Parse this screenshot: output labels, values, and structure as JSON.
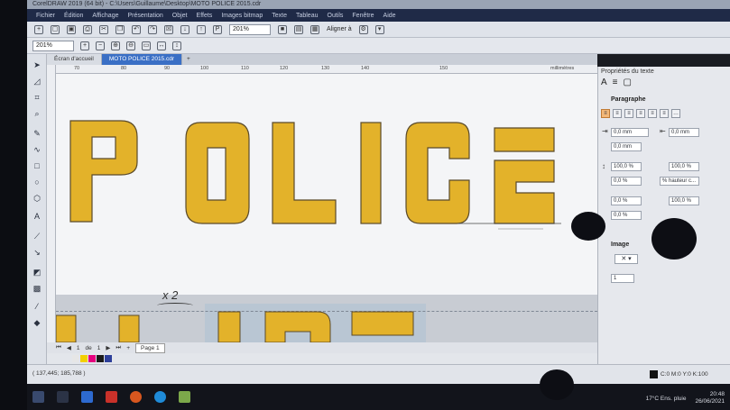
{
  "window": {
    "title": "CorelDRAW 2019 (64 bit) - C:\\Users\\Guillaume\\Desktop\\MOTO POLICE 2015.cdr"
  },
  "menu": [
    "Fichier",
    "Édition",
    "Affichage",
    "Présentation",
    "Objet",
    "Effets",
    "Images bitmap",
    "Texte",
    "Tableau",
    "Outils",
    "Fenêtre",
    "Aide"
  ],
  "toolbar": {
    "zoom_value": "201%",
    "zoom_value2": "201%",
    "align_label": "Aligner à"
  },
  "tabs": [
    {
      "label": "Écran d'accueil",
      "active": false
    },
    {
      "label": "MOTO POLICE 2015.cdr",
      "active": true
    }
  ],
  "ruler": {
    "ticks": [
      "70",
      "80",
      "90",
      "100",
      "110",
      "120",
      "130",
      "140",
      "150"
    ],
    "units": "millimètres"
  },
  "canvas": {
    "main_text": "POLICE",
    "annotation": "x 2",
    "fill_color": "#e3b22a",
    "outline_color": "#5a4a2a"
  },
  "page_nav": {
    "position": "1",
    "of_label": "de",
    "total": "1",
    "page_tab": "Page 1"
  },
  "status": {
    "coordinates": "( 137,445; 185,788 )",
    "color_info": "C:0 M:0 Y:0 K:100"
  },
  "palette": [
    "#e6e6e6",
    "#f2d000",
    "#e5007e",
    "#1a1a1a",
    "#2d3f9a"
  ],
  "docker": {
    "title": "Propriétés du texte",
    "paragraph_heading": "Paragraphe",
    "indent_left": "0,0 mm",
    "indent_right": "0,0 mm",
    "indent_first": "0,0 mm",
    "line_spacing": "100,0 %",
    "para_spacing": "100,0 %",
    "before_para": "0,0 %",
    "spacing_unit": "% hauteur c...",
    "char_spacing": "0,0 %",
    "word_spacing": "100,0 %",
    "lang_spacing": "0,0 %",
    "image_heading": "Image",
    "image_count": "1"
  },
  "taskbar": {
    "weather": "17°C  Ens. pluie",
    "time": "20:48",
    "date": "26/06/2021"
  }
}
